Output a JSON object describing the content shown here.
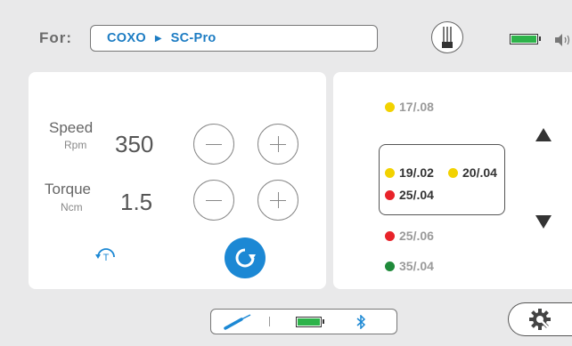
{
  "header": {
    "for_label": "For:",
    "path_brand": "COXO",
    "path_separator": "▶",
    "path_model": "SC-Pro",
    "battery_level": 1.0,
    "battery_color": "#2db34a"
  },
  "params": {
    "speed": {
      "label": "Speed",
      "unit": "Rpm",
      "value": "350"
    },
    "torque": {
      "label": "Torque",
      "unit": "Ncm",
      "value": "1.5"
    }
  },
  "files": {
    "above": [
      {
        "name": "17/.08",
        "color": "#f2d200"
      }
    ],
    "current": [
      {
        "name": "19/.02",
        "color": "#f2d200"
      },
      {
        "name": "20/.04",
        "color": "#f2d200"
      },
      {
        "name": "25/.04",
        "color": "#e8232a"
      }
    ],
    "below": [
      {
        "name": "25/.06",
        "color": "#e8232a"
      },
      {
        "name": "35/.04",
        "color": "#1f8a3a"
      }
    ]
  },
  "status_bar": {
    "battery_level": 1.0,
    "battery_color": "#2db34a",
    "bluetooth_color": "#1c88d4"
  },
  "accent_color": "#1c88d4"
}
